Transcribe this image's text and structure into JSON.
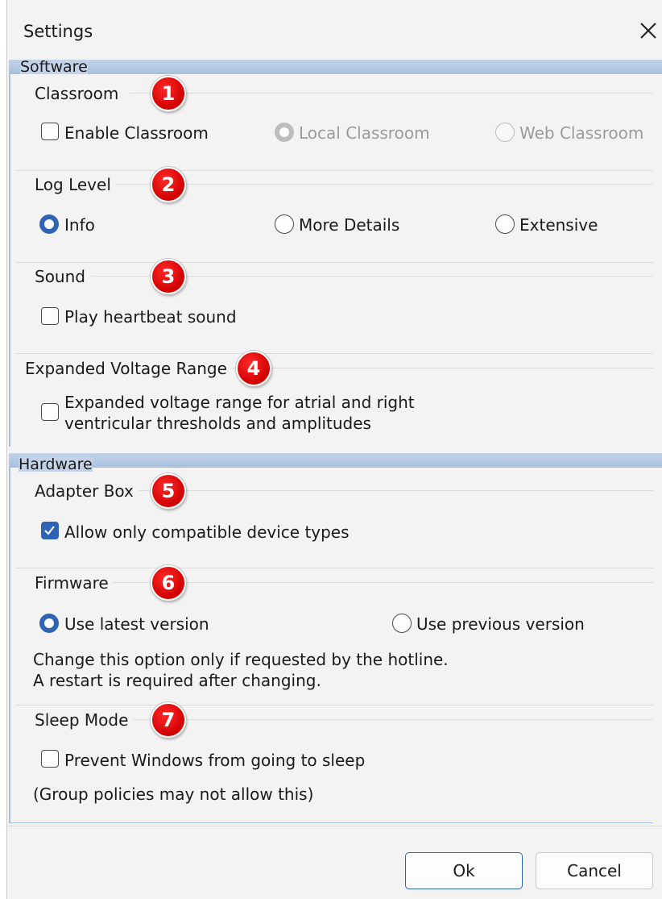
{
  "window": {
    "title": "Settings"
  },
  "software": {
    "title": "Software",
    "classroom": {
      "title": "Classroom",
      "badge": "1",
      "enable_label": "Enable Classroom",
      "local_label": "Local Classroom",
      "web_label": "Web Classroom"
    },
    "log_level": {
      "title": "Log Level",
      "badge": "2",
      "options": [
        "Info",
        "More Details",
        "Extensive"
      ],
      "selected": "Info"
    },
    "sound": {
      "title": "Sound",
      "badge": "3",
      "heartbeat_label": "Play heartbeat sound"
    },
    "voltage": {
      "title": "Expanded Voltage Range",
      "badge": "4",
      "label_line1": "Expanded voltage range for atrial and right",
      "label_line2": "ventricular thresholds and amplitudes"
    }
  },
  "hardware": {
    "title": "Hardware",
    "adapter": {
      "title": "Adapter Box",
      "badge": "5",
      "compatible_label": "Allow only compatible device types",
      "compatible_checked": true
    },
    "firmware": {
      "title": "Firmware",
      "badge": "6",
      "latest_label": "Use latest version",
      "previous_label": "Use previous version",
      "selected": "Use latest version",
      "note_line1": "Change this option only if requested by the hotline.",
      "note_line2": "A restart is required after changing."
    },
    "sleep": {
      "title": "Sleep Mode",
      "badge": "7",
      "prevent_label": "Prevent Windows from going to sleep",
      "note": "(Group policies may not allow this)"
    }
  },
  "buttons": {
    "ok": "Ok",
    "cancel": "Cancel"
  },
  "colors": {
    "accent": "#2f64b4",
    "badge": "#e00000",
    "group_header": "#b4c9e3"
  },
  "icons": {
    "close": "close-icon",
    "checkmark": "checkmark-icon"
  }
}
